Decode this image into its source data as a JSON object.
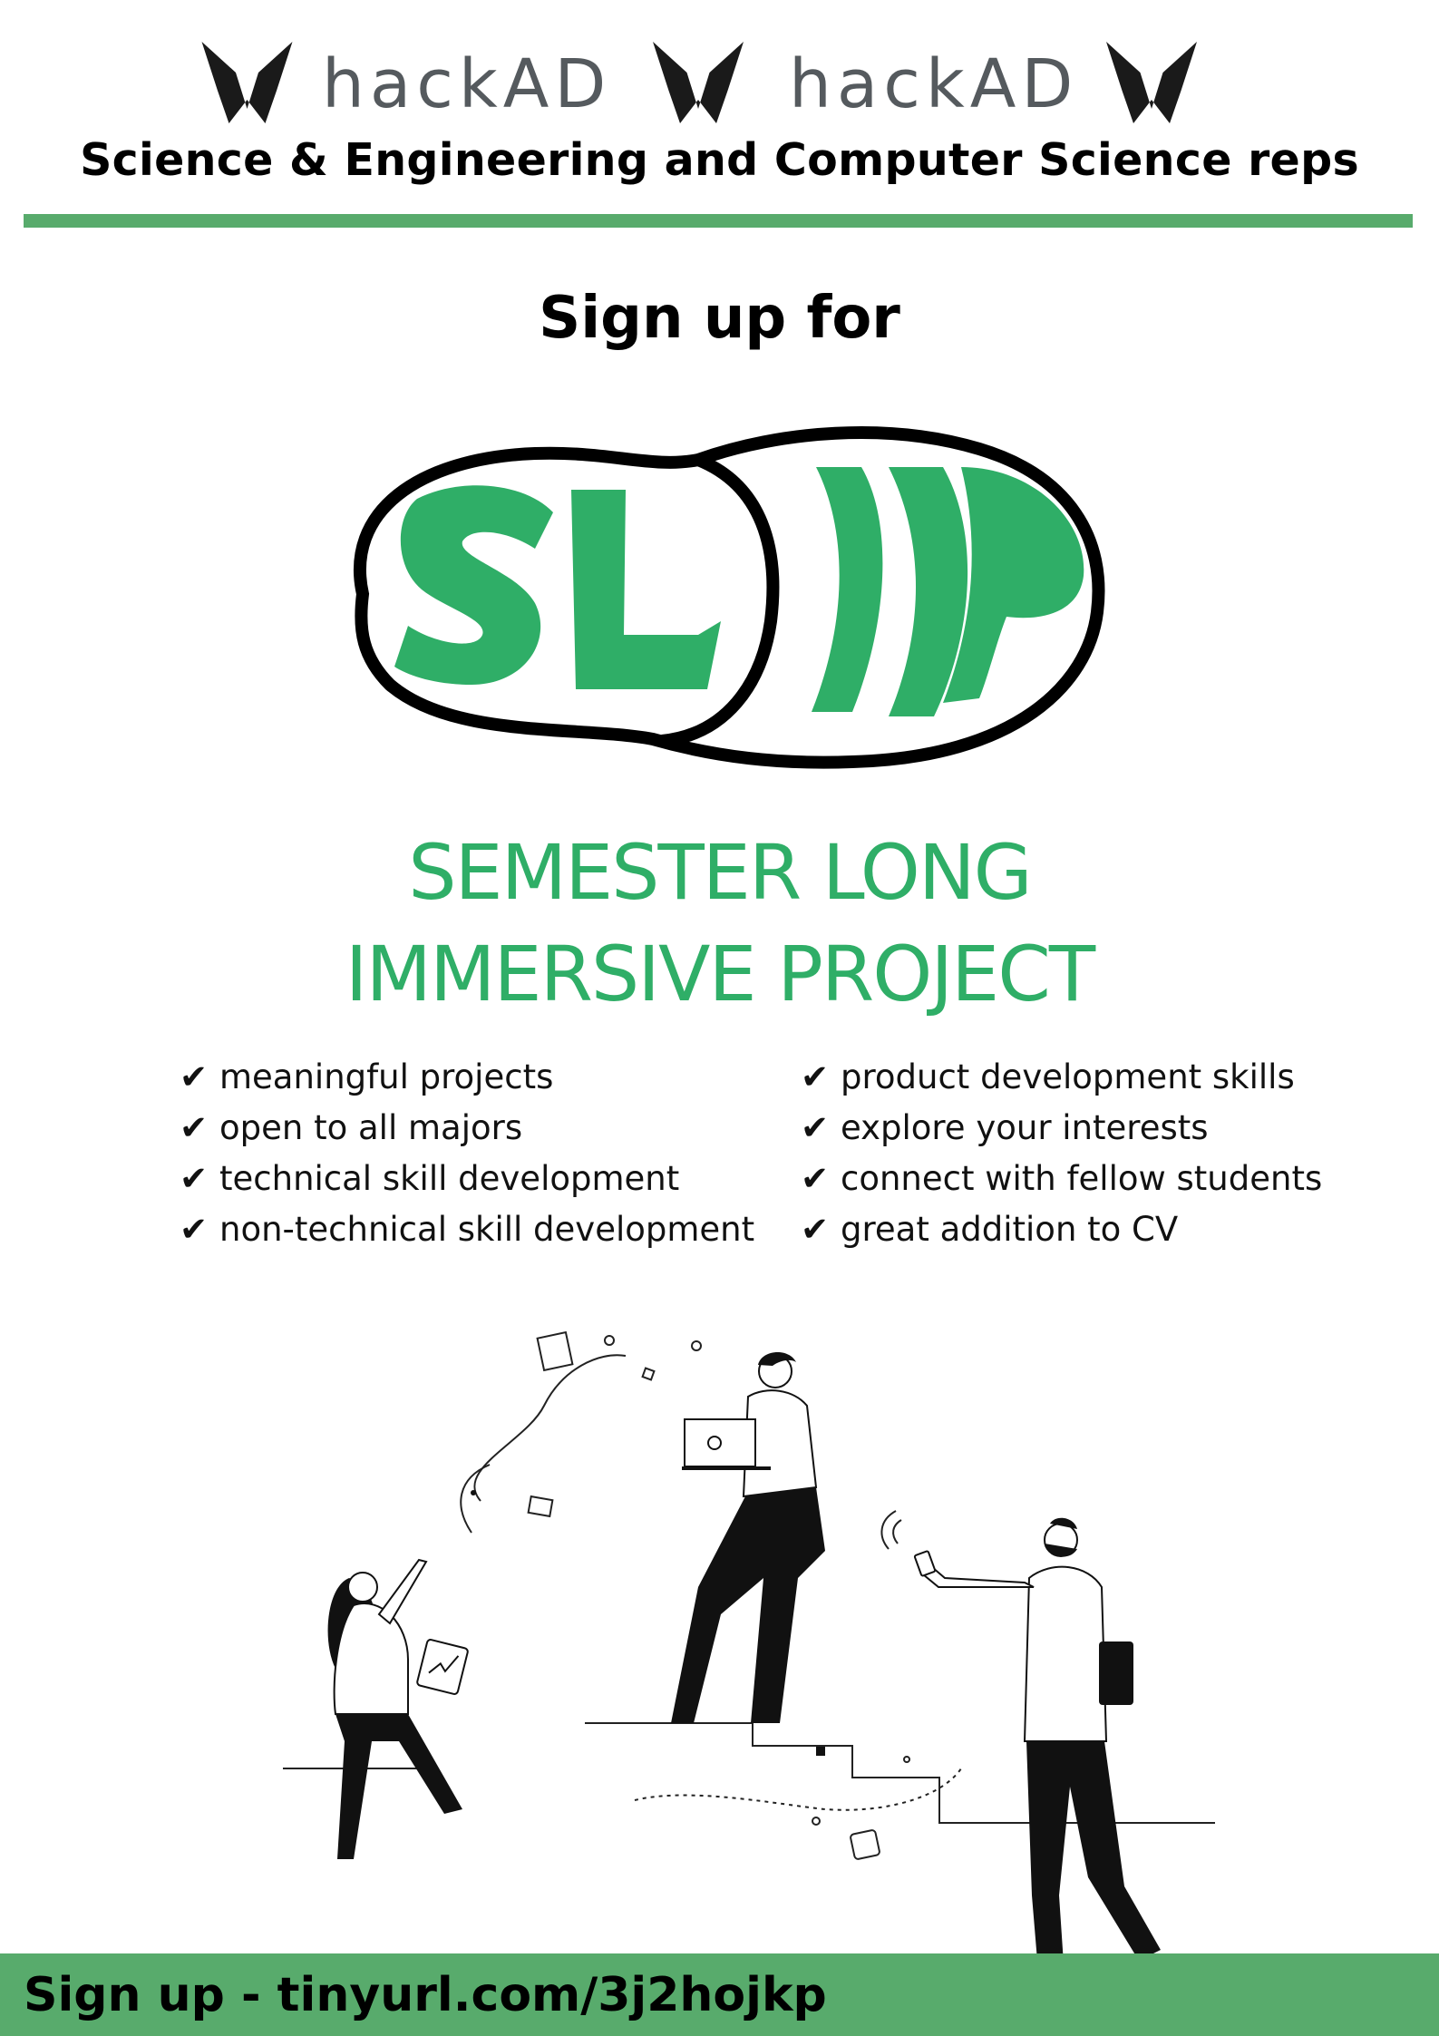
{
  "header": {
    "logo_text": "hackAD",
    "reps_line": "Science & Engineering and Computer Science reps"
  },
  "intro": {
    "signup_for": "Sign up for"
  },
  "slip_logo": {
    "wordmark": "SLIP",
    "subtitle_line1": "SEMESTER LONG",
    "subtitle_line2": "IMMERSIVE PROJECT"
  },
  "features": {
    "check_glyph": "✔",
    "left": [
      "meaningful projects",
      "open to all majors",
      "technical skill development",
      "non-technical skill development"
    ],
    "right": [
      "product development skills",
      "explore your interests",
      "connect with fellow students",
      "great addition to CV"
    ]
  },
  "footer": {
    "signup_text": "Sign up - tinyurl.com/3j2hojkp"
  },
  "colors": {
    "accent_green": "#2fae67",
    "bar_green": "#58ab6c",
    "logo_gray": "#555a5e",
    "ink": "#000000"
  },
  "icons": {
    "header_logo": "hackad-butterfly-icon",
    "illustration": "team-collaboration-illustration"
  }
}
